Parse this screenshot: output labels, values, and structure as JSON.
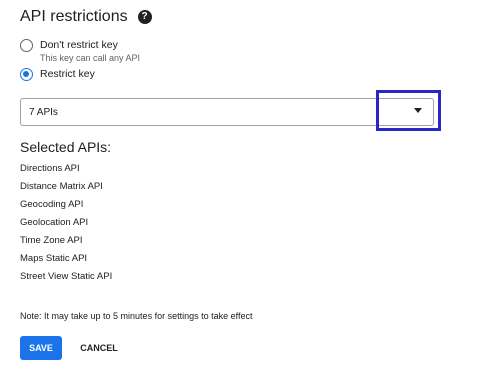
{
  "section": {
    "title": "API restrictions",
    "help_icon": "help-circle-icon"
  },
  "restriction_options": [
    {
      "label": "Don't restrict key",
      "sublabel": "This key can call any API",
      "selected": false
    },
    {
      "label": "Restrict key",
      "selected": true
    }
  ],
  "api_select": {
    "value": "7 APIs",
    "arrow_icon": "dropdown-arrow-icon"
  },
  "selected_apis": {
    "title": "Selected APIs:",
    "items": [
      "Directions API",
      "Distance Matrix API",
      "Geocoding API",
      "Geolocation API",
      "Time Zone API",
      "Maps Static API",
      "Street View Static API"
    ]
  },
  "note": "Note: It may take up to 5 minutes for settings to take effect",
  "actions": {
    "save_label": "SAVE",
    "cancel_label": "CANCEL"
  },
  "colors": {
    "accent": "#1a73e8",
    "highlight_box": "#2a27c4",
    "text": "#202124",
    "secondary_text": "#5f6368"
  }
}
